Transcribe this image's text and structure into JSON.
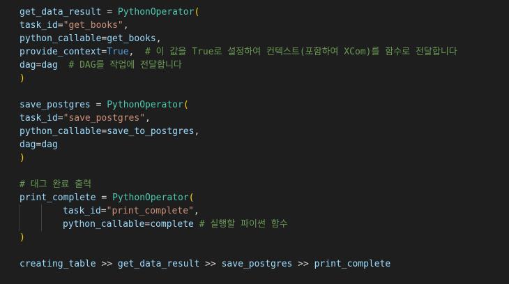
{
  "editor": {
    "lines": [
      {
        "indent": 0,
        "tokens": [
          {
            "t": "get_data_result",
            "k": "var"
          },
          {
            "t": " = ",
            "k": "op"
          },
          {
            "t": "PythonOperator",
            "k": "cls"
          },
          {
            "t": "(",
            "k": "br"
          }
        ]
      },
      {
        "indent": 0,
        "tokens": [
          {
            "t": "task_id",
            "k": "var"
          },
          {
            "t": "=",
            "k": "op"
          },
          {
            "t": "\"get_books\"",
            "k": "str"
          },
          {
            "t": ",",
            "k": "op"
          }
        ]
      },
      {
        "indent": 0,
        "tokens": [
          {
            "t": "python_callable",
            "k": "var"
          },
          {
            "t": "=",
            "k": "op"
          },
          {
            "t": "get_books",
            "k": "var"
          },
          {
            "t": ",",
            "k": "op"
          }
        ]
      },
      {
        "indent": 0,
        "tokens": [
          {
            "t": "provide_context",
            "k": "var"
          },
          {
            "t": "=",
            "k": "op"
          },
          {
            "t": "True",
            "k": "kw"
          },
          {
            "t": ",  ",
            "k": "op"
          },
          {
            "t": "# 이 값을 True로 설정하여 컨텍스트(포함하여 XCom)를 함수로 전달합니다",
            "k": "cm"
          }
        ]
      },
      {
        "indent": 0,
        "tokens": [
          {
            "t": "dag",
            "k": "var"
          },
          {
            "t": "=",
            "k": "op"
          },
          {
            "t": "dag",
            "k": "var"
          },
          {
            "t": "  ",
            "k": "op"
          },
          {
            "t": "# DAG를 작업에 전달합니다",
            "k": "cm"
          }
        ]
      },
      {
        "indent": 0,
        "tokens": [
          {
            "t": ")",
            "k": "br"
          }
        ]
      },
      {
        "indent": 0,
        "tokens": []
      },
      {
        "indent": 0,
        "tokens": [
          {
            "t": "save_postgres",
            "k": "var"
          },
          {
            "t": " = ",
            "k": "op"
          },
          {
            "t": "PythonOperator",
            "k": "cls"
          },
          {
            "t": "(",
            "k": "br"
          }
        ]
      },
      {
        "indent": 0,
        "tokens": [
          {
            "t": "task_id",
            "k": "var"
          },
          {
            "t": "=",
            "k": "op"
          },
          {
            "t": "\"save_postgres\"",
            "k": "str"
          },
          {
            "t": ",",
            "k": "op"
          }
        ]
      },
      {
        "indent": 0,
        "tokens": [
          {
            "t": "python_callable",
            "k": "var"
          },
          {
            "t": "=",
            "k": "op"
          },
          {
            "t": "save_to_postgres",
            "k": "var"
          },
          {
            "t": ",",
            "k": "op"
          }
        ]
      },
      {
        "indent": 0,
        "tokens": [
          {
            "t": "dag",
            "k": "var"
          },
          {
            "t": "=",
            "k": "op"
          },
          {
            "t": "dag",
            "k": "var"
          }
        ]
      },
      {
        "indent": 0,
        "tokens": [
          {
            "t": ")",
            "k": "br"
          }
        ]
      },
      {
        "indent": 0,
        "tokens": []
      },
      {
        "indent": 0,
        "tokens": [
          {
            "t": "# 대그 완료 출력",
            "k": "cm"
          }
        ]
      },
      {
        "indent": 0,
        "tokens": [
          {
            "t": "print_complete",
            "k": "var"
          },
          {
            "t": " = ",
            "k": "op"
          },
          {
            "t": "PythonOperator",
            "k": "cls"
          },
          {
            "t": "(",
            "k": "br"
          }
        ]
      },
      {
        "indent": 2,
        "tokens": [
          {
            "t": "task_id",
            "k": "var"
          },
          {
            "t": "=",
            "k": "op"
          },
          {
            "t": "\"print_complete\"",
            "k": "str"
          },
          {
            "t": ",",
            "k": "op"
          }
        ]
      },
      {
        "indent": 2,
        "tokens": [
          {
            "t": "python_callable",
            "k": "var"
          },
          {
            "t": "=",
            "k": "op"
          },
          {
            "t": "complete",
            "k": "var"
          },
          {
            "t": " ",
            "k": "op"
          },
          {
            "t": "# 실행할 파이썬 함수",
            "k": "cm"
          }
        ]
      },
      {
        "indent": 0,
        "tokens": [
          {
            "t": ")",
            "k": "br"
          }
        ]
      },
      {
        "indent": 0,
        "tokens": []
      },
      {
        "indent": 0,
        "tokens": [
          {
            "t": "creating_table",
            "k": "var"
          },
          {
            "t": " >> ",
            "k": "op"
          },
          {
            "t": "get_data_result",
            "k": "var"
          },
          {
            "t": " >> ",
            "k": "op"
          },
          {
            "t": "save_postgres",
            "k": "var"
          },
          {
            "t": " >> ",
            "k": "op"
          },
          {
            "t": "print_complete",
            "k": "var"
          }
        ]
      }
    ]
  },
  "colors": {
    "background": "#1e1e1e",
    "variable": "#9cdcfe",
    "class": "#4ec9b0",
    "string": "#ce9178",
    "keyword": "#569cd6",
    "comment": "#6a9955",
    "bracket": "#ffd700",
    "plain": "#d4d4d4"
  }
}
